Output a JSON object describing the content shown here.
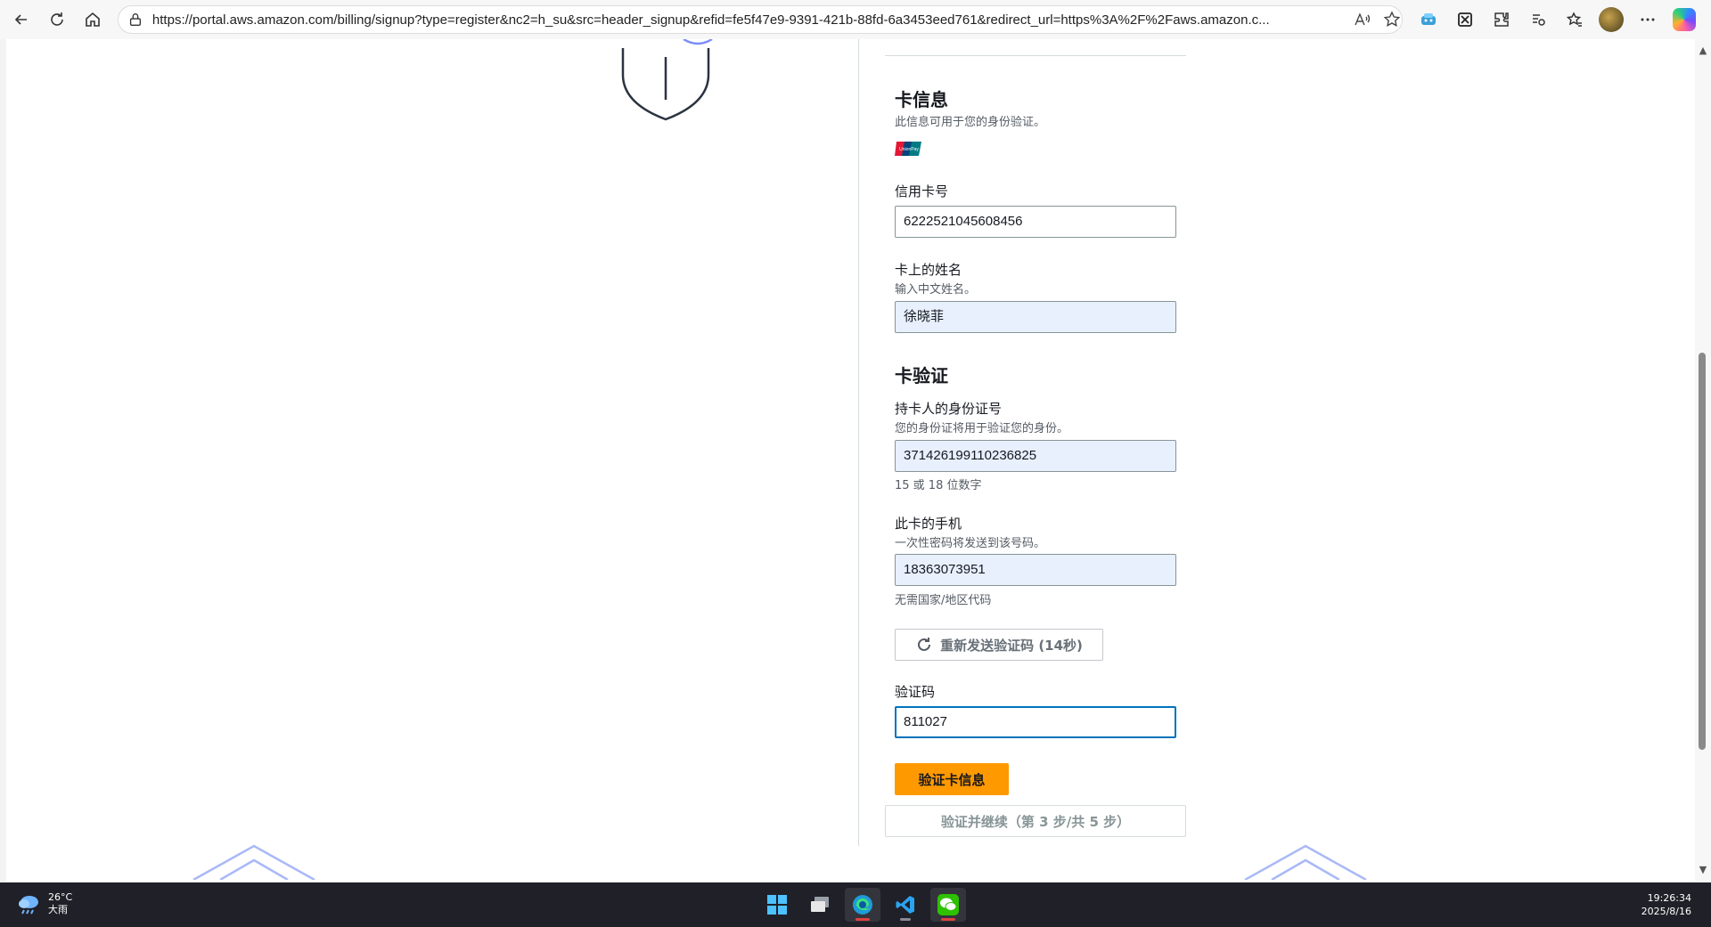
{
  "browser": {
    "url": "https://portal.aws.amazon.com/billing/signup?type=register&nc2=h_su&src=header_signup&refid=fe5f47e9-9391-421b-88fd-6a3453eed761&redirect_url=https%3A%2F%2Faws.amazon.c..."
  },
  "card_info": {
    "title": "卡信息",
    "description": "此信息可用于您的身份验证。",
    "card_logo": "unionpay-logo",
    "card_number": {
      "label": "信用卡号",
      "value": "6222521045608456"
    },
    "name_on_card": {
      "label": "卡上的姓名",
      "hint": "输入中文姓名。",
      "value": "徐晓菲"
    }
  },
  "card_verification": {
    "title": "卡验证",
    "id_number": {
      "label": "持卡人的身份证号",
      "hint": "您的身份证将用于验证您的身份。",
      "value": "371426199110236825",
      "helper": "15 或 18 位数字"
    },
    "phone": {
      "label": "此卡的手机",
      "hint": "一次性密码将发送到该号码。",
      "value": "18363073951",
      "helper": "无需国家/地区代码"
    },
    "resend_button": "重新发送验证码 (14秒)",
    "otp": {
      "label": "验证码",
      "value": "811027"
    },
    "verify_button": "验证卡信息",
    "continue_button": "验证并继续（第 3 步/共 5 步）"
  },
  "taskbar": {
    "weather_temp": "26°C",
    "weather_desc": "大雨",
    "time": "19:26:34",
    "date": "2025/8/16",
    "apps": [
      "start-icon",
      "task-view-icon",
      "edge-icon",
      "vscode-icon",
      "wechat-icon"
    ]
  },
  "colors": {
    "primary_button": "#ff9900",
    "focus_border": "#0073bb",
    "autofill_bg": "#e8f0fe"
  }
}
